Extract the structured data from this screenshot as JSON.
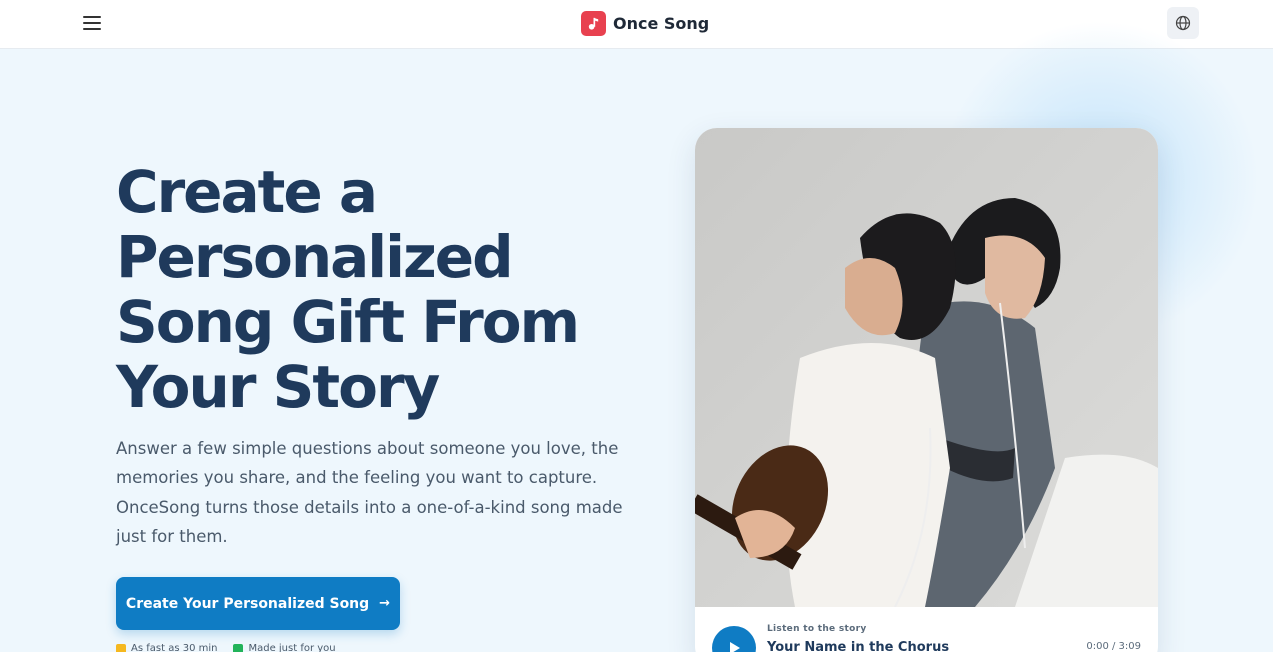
{
  "header": {
    "brand_name": "Once Song",
    "menu_icon": "hamburger-menu-icon",
    "logo_icon": "music-note-icon",
    "language_icon": "globe-icon",
    "accent_color": "#e8414f"
  },
  "hero": {
    "title": "Create a Personalized Song Gift From Your Story",
    "description": "Answer a few simple questions about someone you love, the memories you share, and the feeling you want to capture. OnceSong turns those details into a one-of-a-kind song made just for them.",
    "cta_label": "Create Your Personalized Song",
    "cta_arrow": "→",
    "cta_color": "#0f7cc4",
    "perks": [
      {
        "label": "As fast as 30 min",
        "icon": "lightning-icon"
      },
      {
        "label": "Made just for you",
        "icon": "check-icon"
      }
    ]
  },
  "player": {
    "listen_label": "Listen to the story",
    "song_title": "Your Name in the Chorus",
    "time": "0:00 / 3:09",
    "play_icon": "play-icon"
  }
}
